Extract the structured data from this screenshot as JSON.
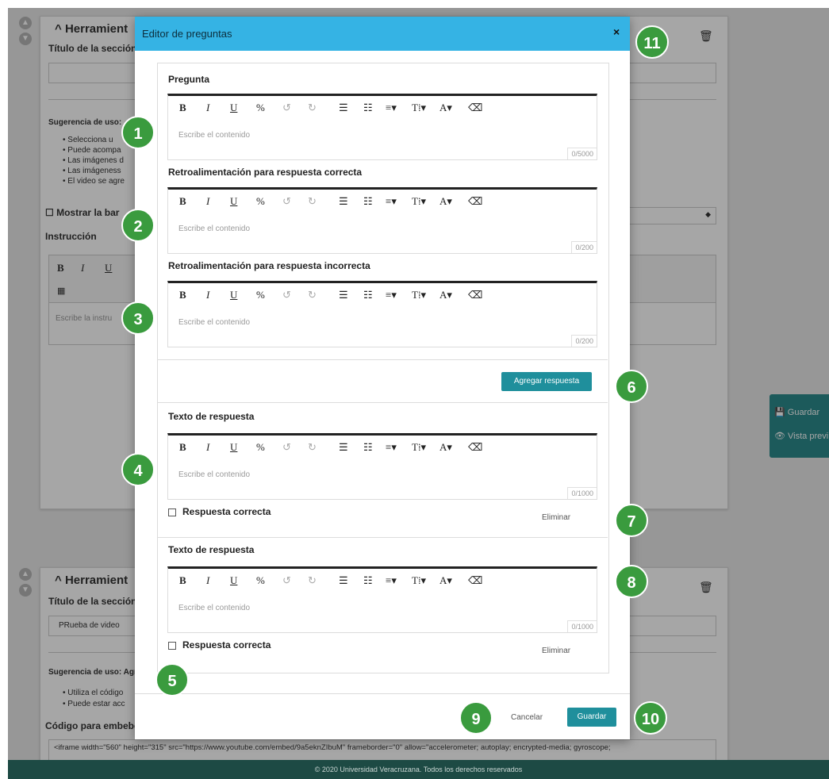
{
  "background": {
    "section1": {
      "title": "Herramient",
      "field_label": "Título de la sección",
      "hint_label": "Sugerencia de uso:",
      "bullets": [
        "Selecciona u",
        "Puede acompa",
        "Las imágenes d",
        "Las imágeness",
        "El video se agre"
      ],
      "checkbox_label": "Mostrar la bar",
      "instruction_label": "Instrucción",
      "instruction_placeholder": "Escribe la instru"
    },
    "section2": {
      "title": "Herramient",
      "field_label": "Título de la sección",
      "field_value": "PRueba de video",
      "hint_label": "Sugerencia de uso: Agre",
      "bullets": [
        "Utiliza el código",
        "Puede estar acc"
      ],
      "embed_label": "Código para embebe",
      "embed_code": "<iframe width=\"560\" height=\"315\" src=\"https://www.youtube.com/embed/9a5eknZIbuM\" frameborder=\"0\" allow=\"accelerometer; autoplay; encrypted-media; gyroscope;"
    },
    "side_panel": {
      "save": "Guardar",
      "preview": "Vista previ"
    },
    "footer": "© 2020 Universidad Veracruzana. Todos los derechos reservados"
  },
  "modal": {
    "title": "Editor de preguntas",
    "close": "×",
    "question_label": "Pregunta",
    "correct_feedback_label": "Retroalimentación para respuesta correcta",
    "incorrect_feedback_label": "Retroalimentación para respuesta incorrecta",
    "editor_placeholder": "Escribe el contenido",
    "counters": {
      "question": "0/5000",
      "correct": "0/200",
      "incorrect": "0/200",
      "answer1": "0/1000",
      "answer2": "0/1000"
    },
    "add_answer": "Agregar respuesta",
    "answer_label": "Texto de respuesta",
    "correct_checkbox": "Respuesta correcta",
    "delete": "Eliminar",
    "cancel": "Cancelar",
    "save": "Guardar"
  },
  "toolbar": {
    "bold": "B",
    "italic": "I",
    "underline": "U",
    "link": "%",
    "undo": "↺",
    "redo": "↻",
    "ordered": "☰",
    "unordered": "☷",
    "align": "≡▾",
    "size": "T⁞▾",
    "color": "A▾",
    "clear": "⌫"
  },
  "badges": [
    "1",
    "2",
    "3",
    "4",
    "5",
    "6",
    "7",
    "8",
    "9",
    "10",
    "11"
  ],
  "colors": {
    "header": "#35b3e4",
    "accent": "#1f8f9c",
    "badge": "#3a9b3e",
    "footer": "#1d4a44"
  }
}
